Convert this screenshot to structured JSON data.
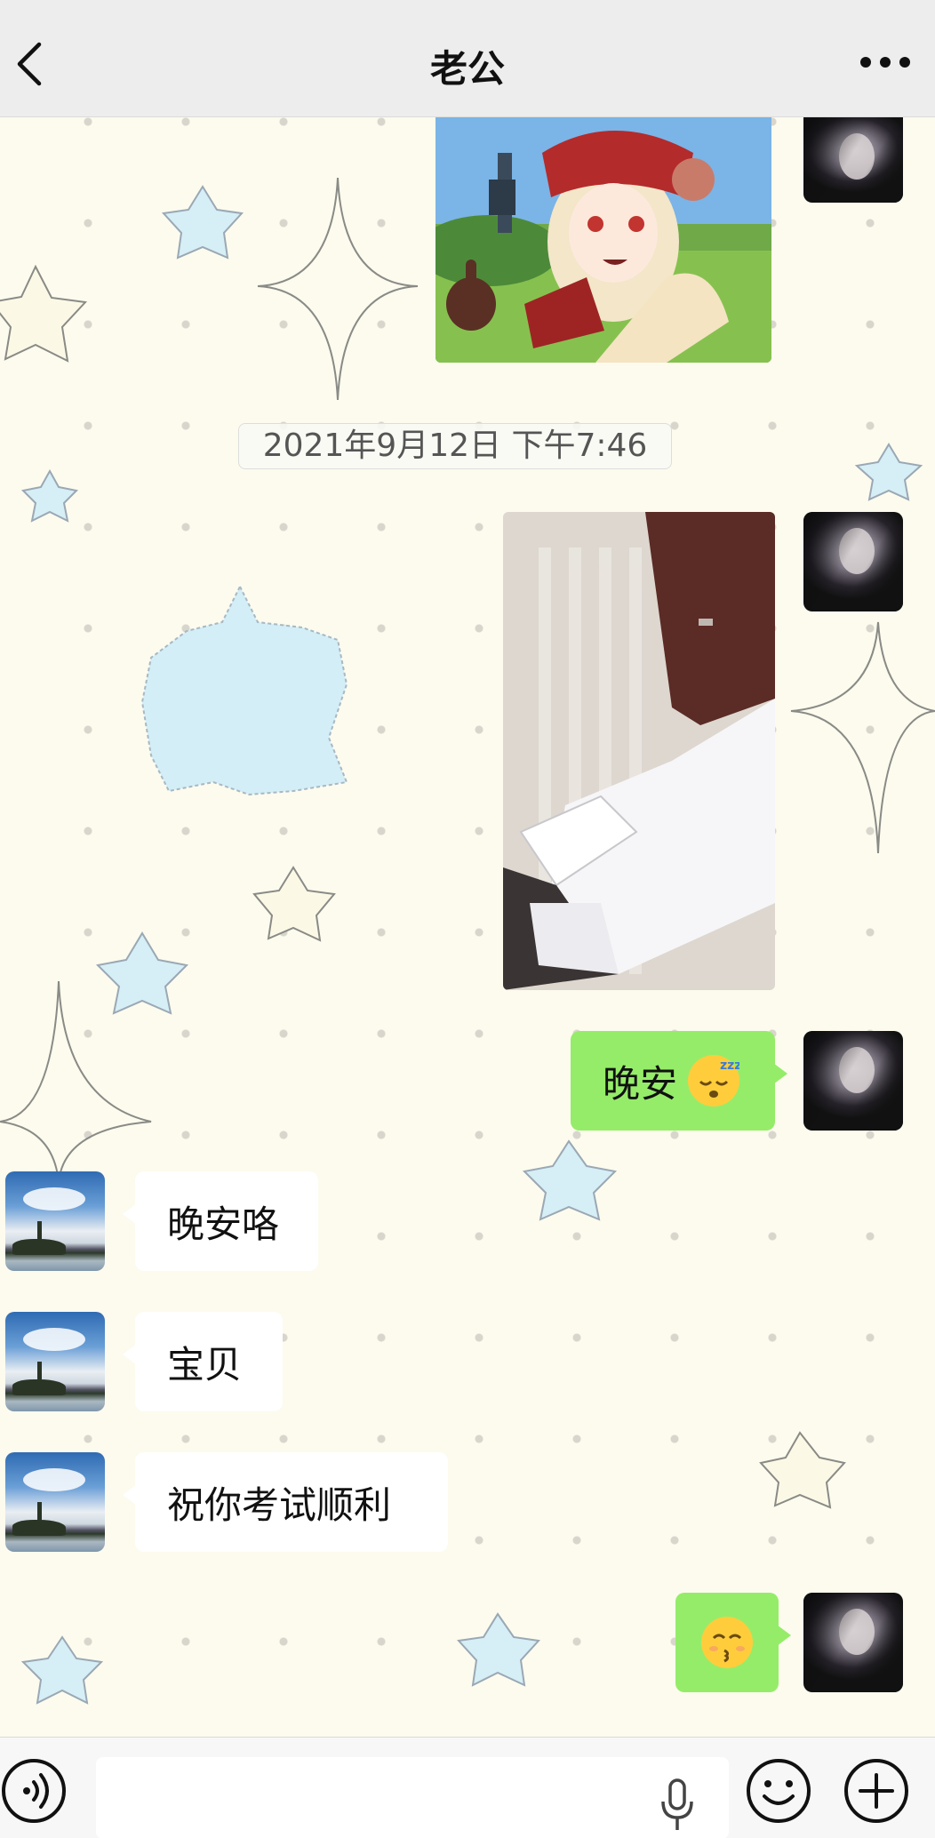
{
  "header": {
    "title": "老公"
  },
  "messages": {
    "timestamp": "2021年9月12日 下午7:46",
    "me_goodnight": "晚安",
    "other_1": "晚安咯",
    "other_2": "宝贝",
    "other_3": "祝你考试顺利"
  },
  "input": {
    "placeholder": ""
  },
  "colors": {
    "bubble_me": "#95ec69",
    "bubble_other": "#ffffff",
    "header_bg": "#ededed"
  },
  "icons": [
    "back-icon",
    "more-icon",
    "voice-icon",
    "mic-icon",
    "emoji-icon",
    "plus-icon"
  ]
}
